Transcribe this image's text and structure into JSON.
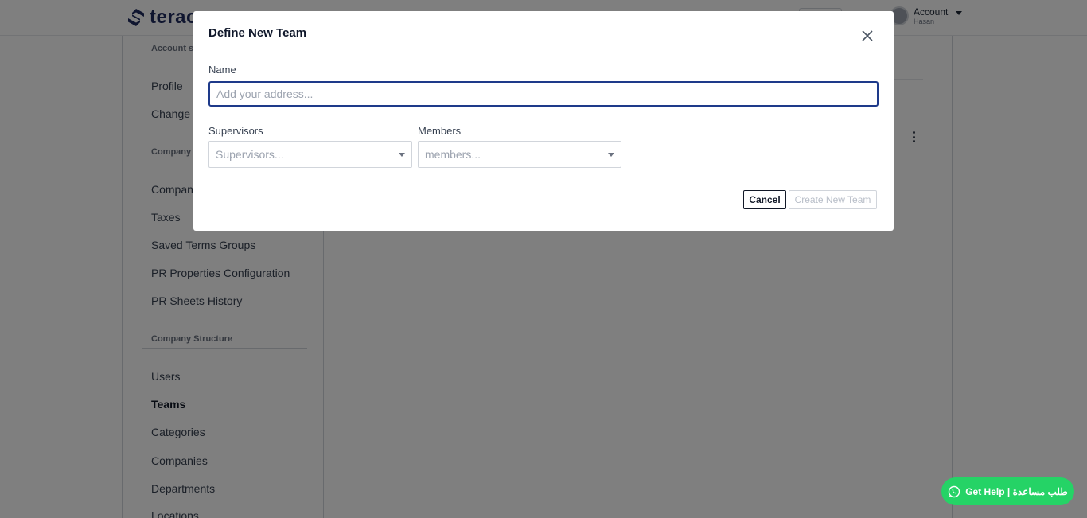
{
  "app": {
    "logo_text": "terac"
  },
  "header": {
    "account_label": "Account",
    "account_sub": "Hasan"
  },
  "sidebar": {
    "sections": [
      {
        "title": "Account s"
      },
      {
        "title": "Company"
      },
      {
        "title": "Company Structure"
      }
    ],
    "items": [
      {
        "label": "Profile"
      },
      {
        "label": "Change P"
      },
      {
        "label": "Company"
      },
      {
        "label": "Taxes"
      },
      {
        "label": "Saved Terms Groups"
      },
      {
        "label": "PR Properties Configuration"
      },
      {
        "label": "PR Sheets History"
      },
      {
        "label": "Users"
      },
      {
        "label": "Teams"
      },
      {
        "label": "Categories"
      },
      {
        "label": "Companies"
      },
      {
        "label": "Departments"
      },
      {
        "label": "Locations"
      }
    ],
    "active_item": "Teams"
  },
  "modal": {
    "title": "Define New Team",
    "name_label": "Name",
    "name_value": "",
    "name_placeholder": "Add your address...",
    "supervisors_label": "Supervisors",
    "supervisors_placeholder": "Supervisors...",
    "members_label": "Members",
    "members_placeholder": "members...",
    "cancel_label": "Cancel",
    "create_label": "Create New Team"
  },
  "help": {
    "label": "Get Help | طلب مساعدة"
  },
  "colors": {
    "brand": "#1e2a5e",
    "input_focus": "#1e3a8a",
    "whatsapp": "#25d366",
    "overlay": "rgba(0,0,0,0.5)"
  },
  "icons": [
    "logo-icon",
    "avatar",
    "caret-down-icon",
    "kebab-menu-icon",
    "close-icon",
    "dropdown-arrow-icon",
    "whatsapp-icon"
  ]
}
